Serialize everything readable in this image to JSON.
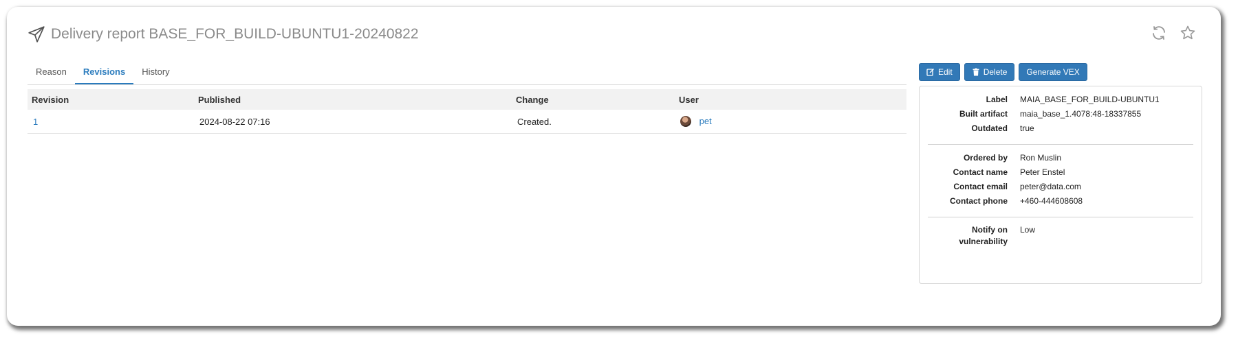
{
  "page": {
    "title": "Delivery report BASE_FOR_BUILD-UBUNTU1-20240822"
  },
  "tabs": [
    "Reason",
    "Revisions",
    "History"
  ],
  "active_tab": "Revisions",
  "table": {
    "headers": [
      "Revision",
      "Published",
      "Change",
      "User"
    ],
    "rows": [
      {
        "revision": "1",
        "published": "2024-08-22 07:16",
        "change": "Created.",
        "user": "pet"
      }
    ]
  },
  "actions": {
    "edit": "Edit",
    "delete": "Delete",
    "generate_vex": "Generate VEX"
  },
  "details": {
    "label": {
      "key": "Label",
      "value": "MAIA_BASE_FOR_BUILD-UBUNTU1"
    },
    "built_artifact": {
      "key": "Built artifact",
      "value": "maia_base_1.4078:48-18337855"
    },
    "outdated": {
      "key": "Outdated",
      "value": "true"
    },
    "ordered_by": {
      "key": "Ordered by",
      "value": "Ron Muslin"
    },
    "contact_name": {
      "key": "Contact name",
      "value": "Peter Enstel"
    },
    "contact_email": {
      "key": "Contact email",
      "value": "peter@data.com"
    },
    "contact_phone": {
      "key": "Contact phone",
      "value": "+460-444608608"
    },
    "notify": {
      "key_line1": "Notify on",
      "key_line2": "vulnerability",
      "value": "Low"
    }
  },
  "colors": {
    "accent": "#2a7bbd",
    "button": "#3279b7"
  },
  "icons": {
    "title": "paper-plane-icon",
    "refresh": "refresh-icon",
    "favorite": "star-icon",
    "edit": "edit-icon",
    "delete": "trash-icon"
  }
}
